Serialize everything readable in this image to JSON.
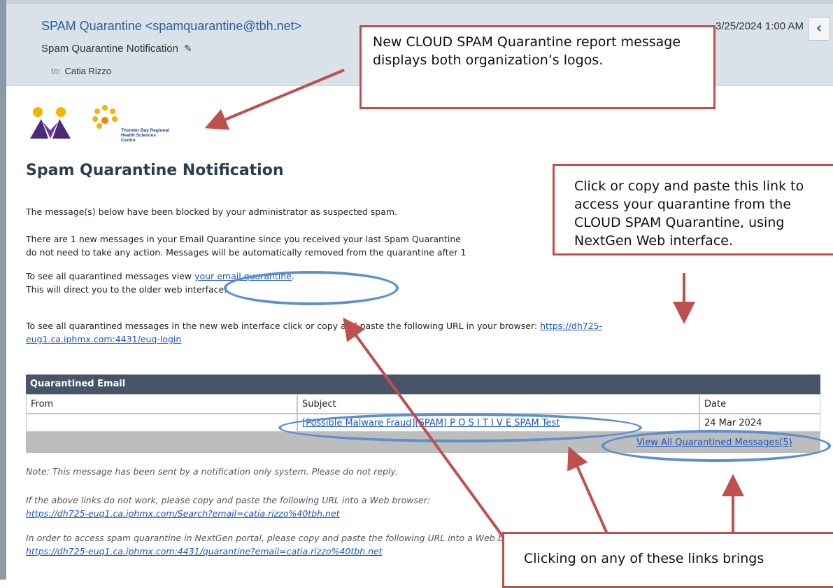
{
  "header": {
    "sender": "SPAM Quarantine <spamquarantine@tbh.net>",
    "subject": "Spam Quarantine Notification",
    "pencil_icon": "✎",
    "to_label": "to:",
    "to_name": "Catia Rizzo",
    "date": "3/25/2024 1:00 AM",
    "prev_icon": "‹"
  },
  "logo_text": [
    "Thunder Bay Regional",
    "Health Sciences",
    "Centre"
  ],
  "body": {
    "title": "Spam Quarantine Notification",
    "p1": "The message(s) below have been blocked by your administrator as suspected spam.",
    "p2_line1": "There are 1 new messages in your Email Quarantine since you received your last Spam Quarantine",
    "p2_line2": "do not need to take any action. Messages will be automatically removed from the quarantine after 1",
    "p3_prefix": "To see all quarantined messages view ",
    "p3_link": "your email quarantine",
    "p3_suffix": ".",
    "p4": "This will direct you to the older web interface.",
    "p5_prefix": "To see all quarantined messages in the new web interface click or copy and paste the following URL in your browser: ",
    "p5_link1": "https://dh725-",
    "p5_link2": "eug1.ca.iphmx.com:4431/euq-login"
  },
  "table": {
    "title": "Quarantined Email",
    "columns": [
      "From",
      "Subject",
      "Date"
    ],
    "row": {
      "from": "",
      "subject": "[Possible Malware Fraud][SPAM] P O S I T I V E SPAM Test",
      "date": "24 Mar 2024"
    },
    "view_all": "View All Quarantined Messages(5)"
  },
  "footer": {
    "note": "Note: This message has been sent by a notification only system. Please do not reply.",
    "f1": "If the above links do not work, please copy and paste the following URL into a Web browser:",
    "f1_link": "https://dh725-euq1.ca.iphmx.com/Search?email=catia.rizzo%40tbh.net",
    "f2": "In order to access spam quarantine in NextGen portal, please copy and paste the following URL into a Web browser:",
    "f2_link": "https://dh725-euq1.ca.iphmx.com:4431/quarantine?email=catia.rizzo%40tbh.net"
  },
  "callouts": {
    "c1": "New CLOUD SPAM Quarantine report message displays both organization’s logos.",
    "c2": "Click or copy and paste this link to access your quarantine from the CLOUD SPAM Quarantine, using NextGen Web interface.",
    "c3": "Clicking on any of these links brings"
  },
  "colors": {
    "callout_border": "#c0504d",
    "arrow": "#c0504d",
    "highlight_ellipse": "#5b8fcf",
    "table_header": "#475568",
    "link": "#1a56c4"
  }
}
